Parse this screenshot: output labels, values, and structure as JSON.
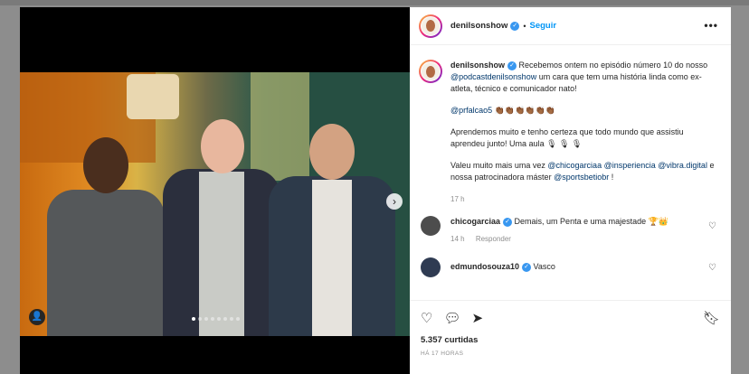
{
  "post": {
    "username": "denilsonshow",
    "separator": "•",
    "follow_label": "Seguir",
    "more_label": "•••",
    "caption": {
      "intro": "Recebemos ontem no episódio número 10 do nosso",
      "mention_podcast": "@podcastdenilsonshow",
      "intro_rest": "um cara que tem uma história linda como ex-atleta, técnico e comunicador nato!",
      "mention_guest": "@prfalcao5",
      "clap_emojis": "👏🏾👏🏾👏🏾👏🏾👏🏾👏🏾",
      "para2": "Aprendemos muito e tenho certeza que todo mundo que assistiu aprendeu junto! Uma aula 🎙 🎙 🎙",
      "para3_start": "Valeu muito mais uma vez",
      "mention_a": "@chicogarciaa",
      "mention_b": "@insperiencia",
      "mention_c": "@vibra.digital",
      "para3_mid": "e nossa patrocinadora máster",
      "mention_d": "@sportsbetiobr",
      "para3_end": "!",
      "time": "17 h"
    },
    "comments": [
      {
        "username": "chicogarciaa",
        "text": "Demais, um Penta e uma majestade 🏆👑",
        "time": "14 h",
        "reply_label": "Responder"
      },
      {
        "username": "edmundosouza10",
        "text": "Vasco"
      }
    ],
    "likes": "5.357 curtidas",
    "posted_ago": "HÁ 17 HORAS",
    "carousel": {
      "count": 8,
      "active": 0
    }
  },
  "icons": {
    "heart": "heart-icon",
    "comment": "comment-icon",
    "share": "share-icon",
    "bookmark": "bookmark-icon",
    "next": "chevron-right-icon",
    "tag": "user-tag-icon"
  },
  "colors": {
    "accent": "#0095f6",
    "verified": "#3897f0"
  }
}
